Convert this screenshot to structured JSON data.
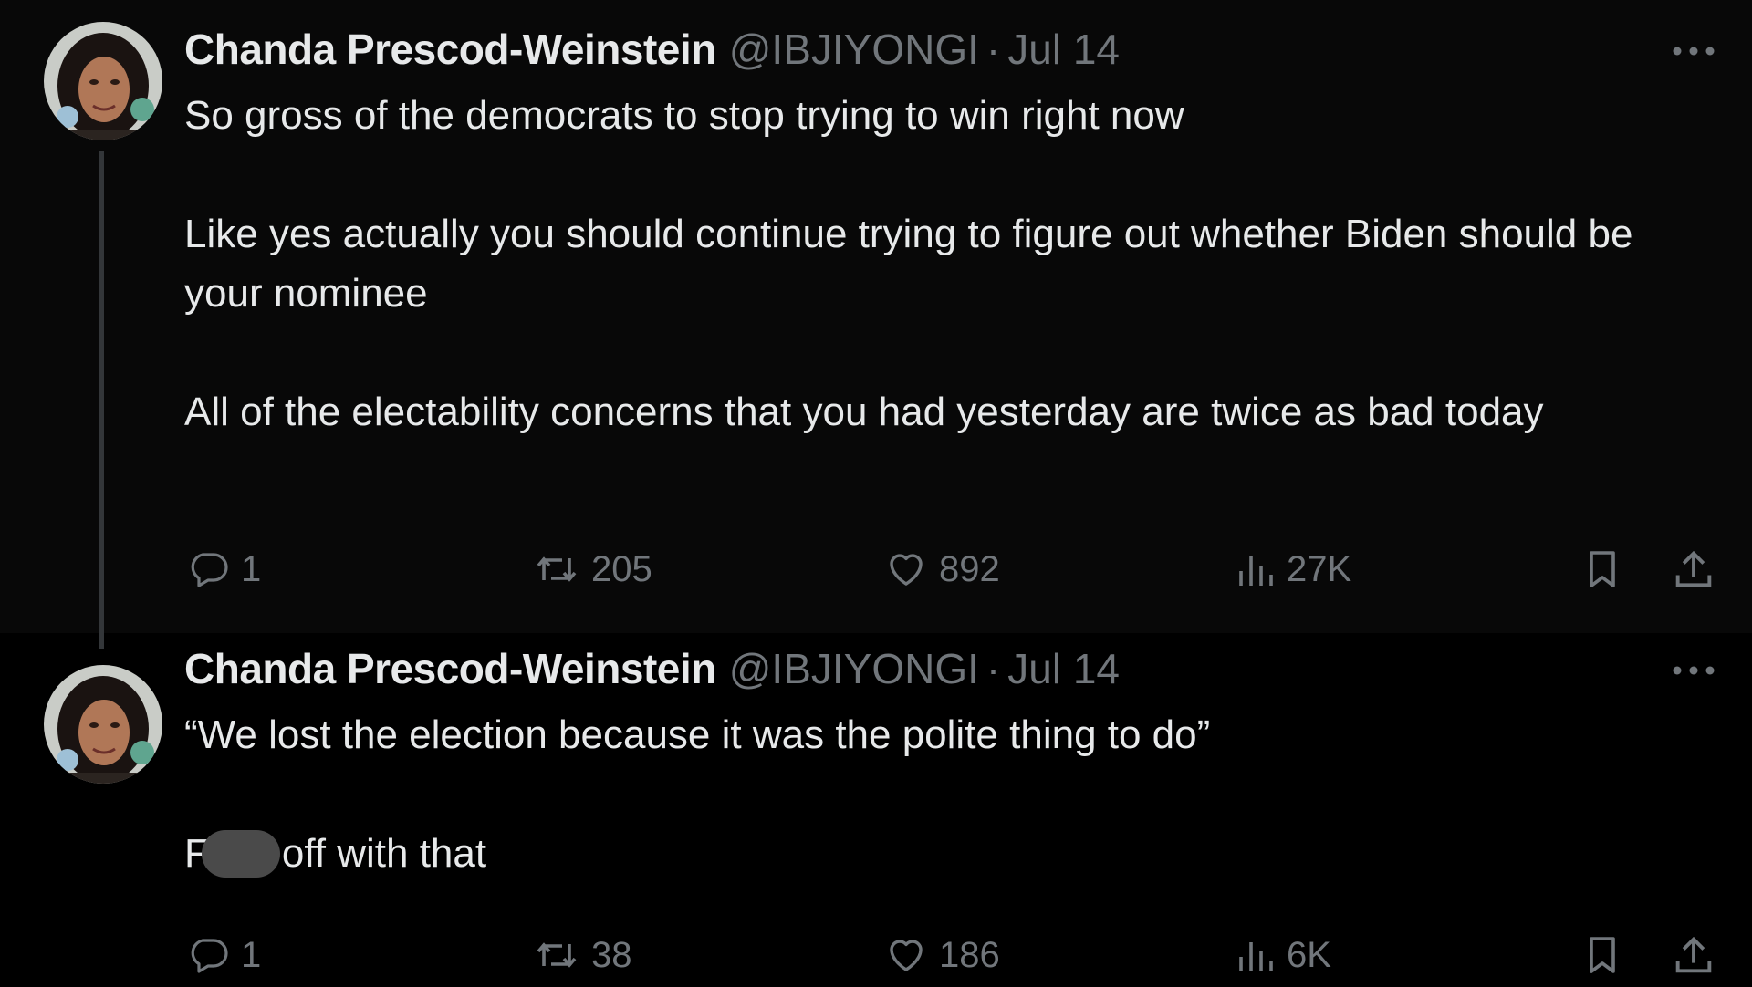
{
  "tweets": [
    {
      "author": {
        "display_name": "Chanda Prescod-Weinstein",
        "handle": "@IBJIYONGI"
      },
      "separator": "·",
      "date": "Jul 14",
      "paragraphs": [
        "So gross of the democrats to stop trying to win right now",
        "Like yes actually you should continue trying to figure out whether Biden should be your nominee",
        "All of the electability concerns that you had yesterday are twice as bad today"
      ],
      "stats": {
        "replies": "1",
        "reposts": "205",
        "likes": "892",
        "views": "27K"
      }
    },
    {
      "author": {
        "display_name": "Chanda Prescod-Weinstein",
        "handle": "@IBJIYONGI"
      },
      "separator": "·",
      "date": "Jul 14",
      "paragraphs": [
        "“We lost the election because it was the polite thing to do”"
      ],
      "censored_line": {
        "prefix": "F",
        "suffix": "off with that"
      },
      "stats": {
        "replies": "1",
        "reposts": "38",
        "likes": "186",
        "views": "6K"
      }
    }
  ],
  "icons": {
    "more": "more-horizontal-icon",
    "reply": "reply-bubble-icon",
    "repost": "repost-arrows-icon",
    "like": "heart-icon",
    "views": "views-bar-chart-icon",
    "bookmark": "bookmark-icon",
    "share": "share-upload-icon"
  },
  "colors": {
    "background": "#000000",
    "text_primary": "#e7e9ea",
    "text_secondary": "#71767b",
    "thread_line": "#333639"
  }
}
